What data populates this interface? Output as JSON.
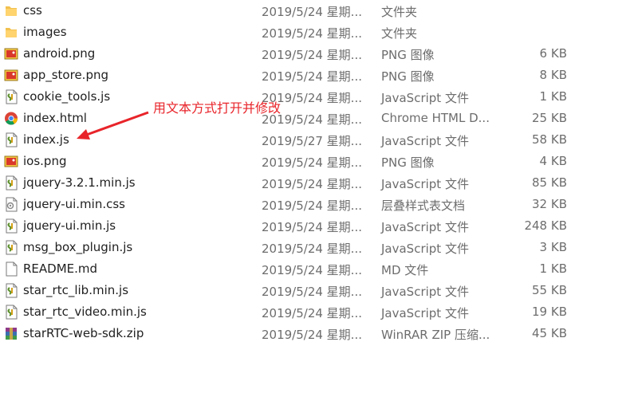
{
  "files": [
    {
      "name": "css",
      "date": "2019/5/24 星期...",
      "type": "文件夹",
      "size": "",
      "icon": "folder-icon"
    },
    {
      "name": "images",
      "date": "2019/5/24 星期...",
      "type": "文件夹",
      "size": "",
      "icon": "folder-icon"
    },
    {
      "name": "android.png",
      "date": "2019/5/24 星期...",
      "type": "PNG 图像",
      "size": "6 KB",
      "icon": "image-file-icon"
    },
    {
      "name": "app_store.png",
      "date": "2019/5/24 星期...",
      "type": "PNG 图像",
      "size": "8 KB",
      "icon": "image-file-icon"
    },
    {
      "name": "cookie_tools.js",
      "date": "2019/5/24 星期...",
      "type": "JavaScript 文件",
      "size": "1 KB",
      "icon": "js-file-icon"
    },
    {
      "name": "index.html",
      "date": "2019/5/24 星期...",
      "type": "Chrome HTML D...",
      "size": "25 KB",
      "icon": "chrome-html-icon"
    },
    {
      "name": "index.js",
      "date": "2019/5/27 星期...",
      "type": "JavaScript 文件",
      "size": "58 KB",
      "icon": "js-file-icon"
    },
    {
      "name": "ios.png",
      "date": "2019/5/24 星期...",
      "type": "PNG 图像",
      "size": "4 KB",
      "icon": "image-file-icon"
    },
    {
      "name": "jquery-3.2.1.min.js",
      "date": "2019/5/24 星期...",
      "type": "JavaScript 文件",
      "size": "85 KB",
      "icon": "js-file-icon"
    },
    {
      "name": "jquery-ui.min.css",
      "date": "2019/5/24 星期...",
      "type": "层叠样式表文档",
      "size": "32 KB",
      "icon": "css-file-icon"
    },
    {
      "name": "jquery-ui.min.js",
      "date": "2019/5/24 星期...",
      "type": "JavaScript 文件",
      "size": "248 KB",
      "icon": "js-file-icon"
    },
    {
      "name": "msg_box_plugin.js",
      "date": "2019/5/24 星期...",
      "type": "JavaScript 文件",
      "size": "3 KB",
      "icon": "js-file-icon"
    },
    {
      "name": "README.md",
      "date": "2019/5/24 星期...",
      "type": "MD 文件",
      "size": "1 KB",
      "icon": "text-file-icon"
    },
    {
      "name": "star_rtc_lib.min.js",
      "date": "2019/5/24 星期...",
      "type": "JavaScript 文件",
      "size": "55 KB",
      "icon": "js-file-icon"
    },
    {
      "name": "star_rtc_video.min.js",
      "date": "2019/5/24 星期...",
      "type": "JavaScript 文件",
      "size": "19 KB",
      "icon": "js-file-icon"
    },
    {
      "name": "starRTC-web-sdk.zip",
      "date": "2019/5/24 星期...",
      "type": "WinRAR ZIP 压缩...",
      "size": "45 KB",
      "icon": "winrar-zip-icon"
    }
  ],
  "annotation": {
    "text": "用文本方式打开并修改",
    "color": "#e8242a"
  }
}
